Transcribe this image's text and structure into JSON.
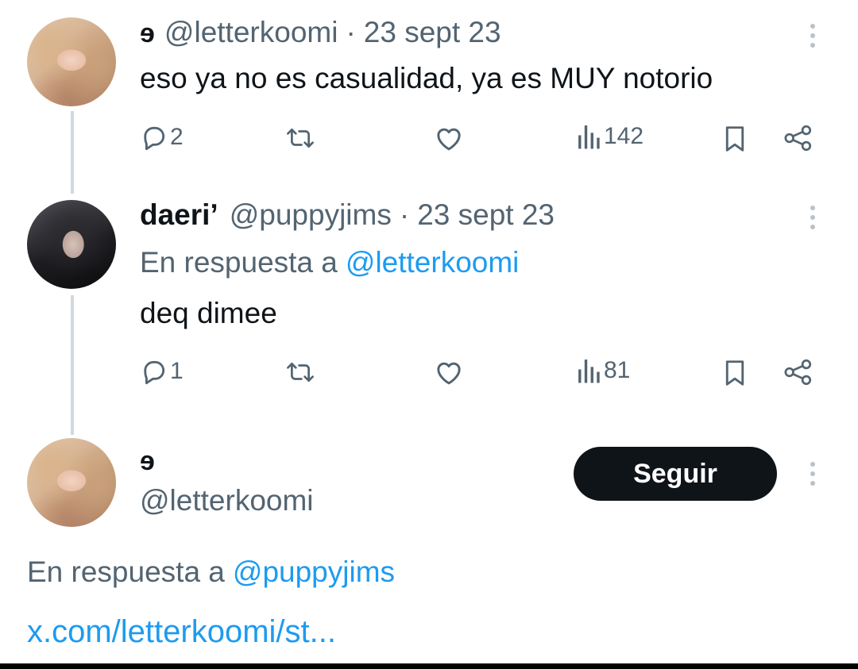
{
  "tweets": [
    {
      "handle_mark": "ɘ",
      "handle": "@letterkoomi",
      "separator": "·",
      "date": "23 sept 23",
      "text": "eso ya no es casualidad, ya es MUY notorio",
      "replies": "2",
      "views": "142"
    },
    {
      "name": "daeri’",
      "handle": "@puppyjims",
      "separator": "·",
      "date": "23 sept 23",
      "reply_prefix": "En respuesta a",
      "reply_to": "@letterkoomi",
      "text": "deq dimee",
      "replies": "1",
      "views": "81"
    }
  ],
  "focused": {
    "handle_mark": "ɘ",
    "handle": "@letterkoomi",
    "follow_label": "Seguir",
    "reply_prefix": "En respuesta a",
    "reply_to": "@puppyjims",
    "link_text": "x.com/letterkoomi/st..."
  },
  "icons": [
    "reply-icon",
    "retweet-icon",
    "like-icon",
    "views-icon",
    "bookmark-icon",
    "share-icon",
    "more-icon"
  ],
  "colors": {
    "text": "#0f1419",
    "muted": "#536471",
    "link": "#1d9bf0",
    "button_bg": "#0f1419",
    "button_text": "#ffffff"
  }
}
